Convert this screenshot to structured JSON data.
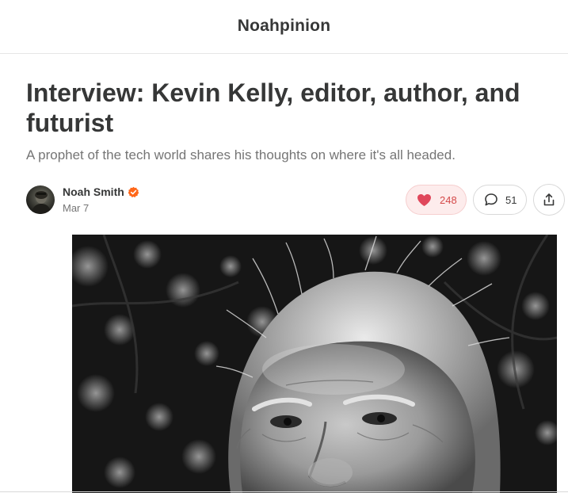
{
  "header": {
    "publication_name": "Noahpinion"
  },
  "post": {
    "title": "Interview: Kevin Kelly, editor, author, and futurist",
    "subtitle": "A prophet of the tech world shares his thoughts on where it's all headed."
  },
  "byline": {
    "author_name": "Noah Smith",
    "date": "Mar 7",
    "verified_icon": "verified-badge-icon",
    "accent_color": "#ff6719"
  },
  "actions": {
    "likes": "248",
    "comments": "51",
    "like_icon": "heart-icon",
    "comment_icon": "comment-bubble-icon",
    "share_icon": "share-icon",
    "like_color": "#d44a4a"
  },
  "hero_image": {
    "description_icon": "portrait-photo"
  }
}
